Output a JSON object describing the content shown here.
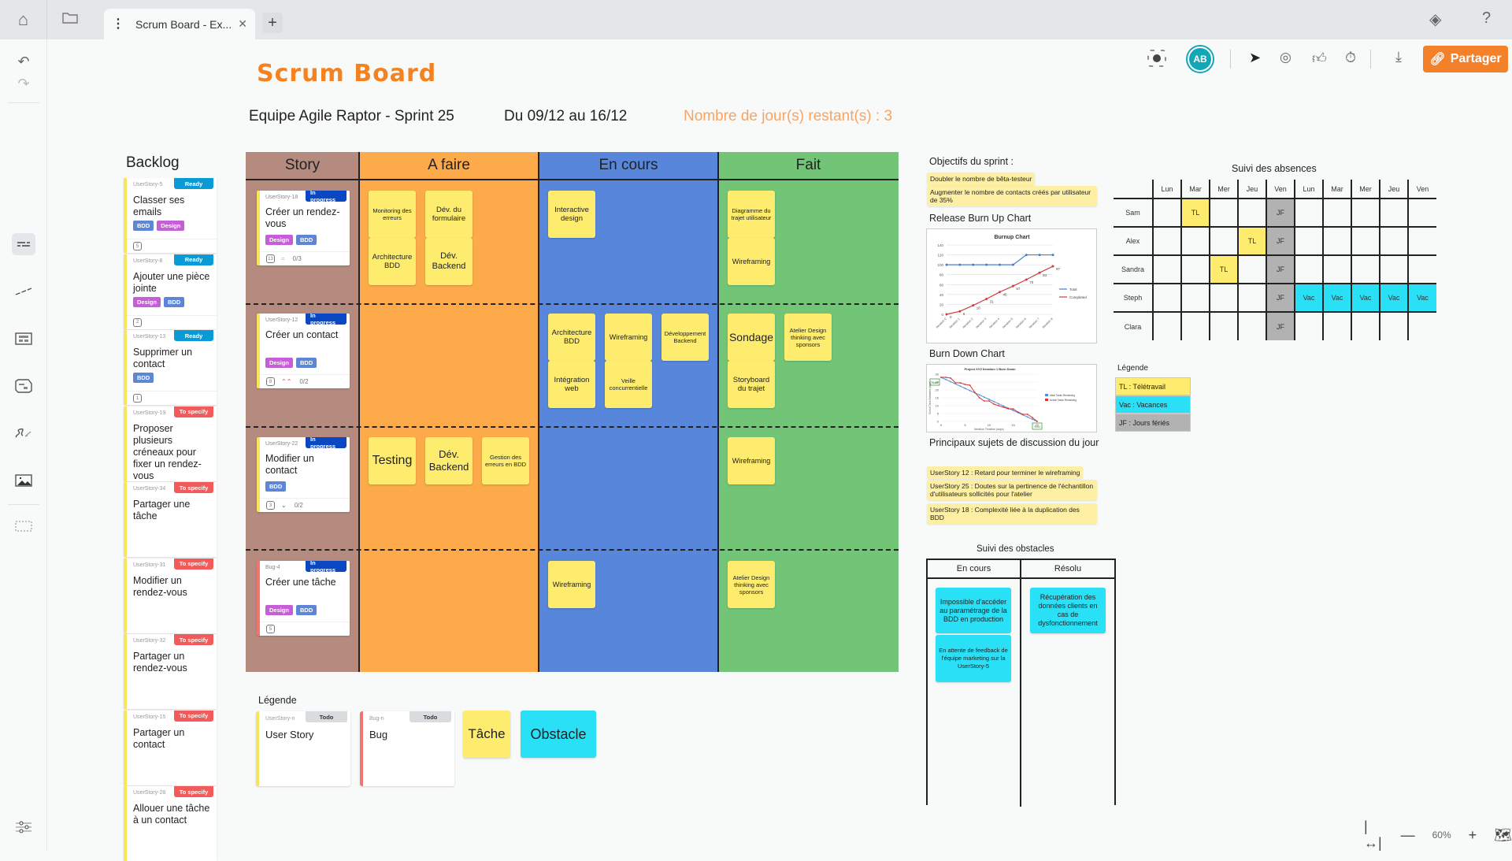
{
  "topbar": {
    "tab_title": "Scrum Board - Ex...",
    "share_label": "Partager",
    "avatar_initials": "AB",
    "zoom_level": "60%"
  },
  "page": {
    "title": "Scrum Board",
    "team": "Equipe Agile Raptor - Sprint 25",
    "dates": "Du 09/12 au 16/12",
    "days_left": "Nombre de jour(s) restant(s) : 3"
  },
  "colors": {
    "story": "#b58b7f",
    "todo": "#fdaa4b",
    "inprogress": "#5886da",
    "done": "#72c577",
    "sticky": "#fdec6e",
    "obstacle": "#29e0f7",
    "accent": "#f2812a"
  },
  "backlog": {
    "title": "Backlog",
    "items": [
      {
        "id": "UserStory-5",
        "status": "Ready",
        "text": "Classer ses emails",
        "tags": [
          "BDD",
          "Design"
        ],
        "points": "5"
      },
      {
        "id": "UserStory-8",
        "status": "Ready",
        "text": "Ajouter une pièce jointe",
        "tags": [
          "Design",
          "BDD"
        ],
        "points": "2"
      },
      {
        "id": "UserStory-13",
        "status": "Ready",
        "text": "Supprimer un contact",
        "tags": [
          "BDD"
        ],
        "points": "1"
      },
      {
        "id": "UserStory-19",
        "status": "To specify",
        "text": "Proposer plusieurs créneaux pour fixer un rendez-vous"
      },
      {
        "id": "UserStory-34",
        "status": "To specify",
        "text": "Partager une tâche"
      },
      {
        "id": "UserStory-31",
        "status": "To specify",
        "text": "Modifier un rendez-vous"
      },
      {
        "id": "UserStory-32",
        "status": "To specify",
        "text": "Partager un rendez-vous"
      },
      {
        "id": "UserStory-15",
        "status": "To specify",
        "text": "Partager un contact"
      },
      {
        "id": "UserStory-28",
        "status": "To specify",
        "text": "Allouer une tâche à un contact"
      }
    ]
  },
  "board": {
    "columns": [
      "Story",
      "A faire",
      "En cours",
      "Fait"
    ],
    "stories": [
      {
        "id": "UserStory-18",
        "status": "In progress",
        "text": "Créer un rendez-vous",
        "tags": [
          "Design",
          "BDD"
        ],
        "points": "13",
        "priority": "=",
        "checklist": "0/3"
      },
      {
        "id": "UserStory-12",
        "status": "In progress",
        "text": "Créer un contact",
        "tags": [
          "Design",
          "BDD"
        ],
        "points": "8",
        "priority": "⌃⌃",
        "checklist": "0/2"
      },
      {
        "id": "UserStory-22",
        "status": "In progress",
        "text": "Modifier un contact",
        "tags": [
          "BDD"
        ],
        "points": "3",
        "priority": "⌄",
        "checklist": "0/2"
      },
      {
        "id": "Bug-4",
        "status": "In progress",
        "text": "Créer une tâche",
        "tags": [
          "Design",
          "BDD"
        ],
        "points": "5"
      }
    ],
    "tasks": {
      "row1": {
        "todo": [
          "Monitoring des erreurs",
          "Dév. du formulaire",
          "Architecture BDD",
          "Dév. Backend"
        ],
        "inprogress": [
          "Interactive design"
        ],
        "done": [
          "Diagramme du trajet utilisateur",
          "Wireframing"
        ]
      },
      "row2": {
        "todo": [],
        "inprogress": [
          "Architecture BDD",
          "Wireframing",
          "Développement Backend",
          "Intégration web",
          "Veille concurrentielle"
        ],
        "done": [
          "Sondage",
          "Atelier Design thinking avec sponsors",
          "Storyboard du trajet"
        ]
      },
      "row3": {
        "todo": [
          "Testing",
          "Dév. Backend",
          "Gestion des erreurs en BDD"
        ],
        "inprogress": [],
        "done": [
          "Wireframing"
        ]
      },
      "row4": {
        "todo": [],
        "inprogress": [
          "Wireframing"
        ],
        "done": [
          "Atelier Design thinking avec sponsors"
        ]
      }
    }
  },
  "legend_bottom": {
    "title": "Légende",
    "userstory": {
      "id": "UserStory-n",
      "status": "Todo",
      "text": "User Story"
    },
    "bug": {
      "id": "Bug-n",
      "status": "Todo",
      "text": "Bug"
    },
    "task": "Tâche",
    "obstacle": "Obstacle"
  },
  "objectives": {
    "title": "Objectifs du sprint :",
    "items": [
      "Doubler le nombre de bêta-testeur",
      "Augmenter le nombre de contacts créés par utilisateur de 35%"
    ]
  },
  "burnup": {
    "label": "Release Burn Up Chart",
    "chart_data": {
      "type": "line",
      "title": "Burnup Chart",
      "categories": [
        "Iteration 0",
        "Iteration 1",
        "Iteration 2",
        "Iteration 3",
        "Iteration 4",
        "Iteration 5",
        "Iteration 6",
        "Iteration 7",
        "Iteration 8"
      ],
      "series": [
        {
          "name": "Total",
          "color": "#4a7cc9",
          "values": [
            100,
            100,
            100,
            100,
            100,
            100,
            120,
            120,
            120
          ]
        },
        {
          "name": "Completed",
          "color": "#c9403f",
          "values": [
            0,
            6,
            18,
            31,
            45,
            57,
            70,
            84,
            97
          ]
        }
      ],
      "ylim": [
        0,
        140
      ],
      "yticks": [
        0,
        20,
        40,
        60,
        80,
        100,
        120,
        140
      ],
      "legend": "right"
    }
  },
  "burndown": {
    "label": "Burn Down Chart",
    "chart_data": {
      "type": "line",
      "title": "Project XYZ Iteration 1 Burn Down",
      "xlabel": "Iteration Timeline (days)",
      "ylabel": "Sum of Task Estimates (days)",
      "x": [
        0,
        1,
        2,
        3,
        4,
        5,
        6,
        7,
        8,
        9,
        10,
        11,
        12,
        13,
        14,
        15,
        16,
        17,
        18,
        19,
        20
      ],
      "series": [
        {
          "name": "Ideal Tasks Remaining",
          "color": "#4a8ee0",
          "values": [
            28,
            26.6,
            25.2,
            23.8,
            22.4,
            21,
            19.6,
            18.2,
            16.8,
            15.4,
            14,
            12.6,
            11.2,
            9.8,
            8.4,
            7,
            5.6,
            4.2,
            2.8,
            1.4,
            0
          ]
        },
        {
          "name": "Actual Tasks Remaining",
          "color": "#d9332b",
          "values": [
            28,
            28,
            27.5,
            24.5,
            24.5,
            23.5,
            23,
            18.5,
            15,
            13,
            13,
            11,
            10,
            9,
            8,
            8,
            6,
            4.5,
            4.5,
            2.5,
            0
          ]
        }
      ],
      "ylim": [
        0,
        30
      ],
      "yticks": [
        0,
        5,
        10,
        15,
        20,
        25,
        30
      ],
      "xticks": [
        0,
        5,
        10,
        15,
        20
      ],
      "annotations": [
        "Start",
        "End"
      ],
      "legend": "right"
    }
  },
  "discussion": {
    "title": "Principaux sujets de discussion du jour",
    "items": [
      "UserStory 12 : Retard pour terminer le wireframing",
      "UserStory 25 : Doutes sur la pertinence de l'échantillon d'utilisateurs sollicités pour l'atelier",
      "UserStory 18 : Complexité liée à la duplication des BDD"
    ]
  },
  "absences": {
    "title": "Suivi des absences",
    "days": [
      "Lun",
      "Mar",
      "Mer",
      "Jeu",
      "Ven",
      "Lun",
      "Mar",
      "Mer",
      "Jeu",
      "Ven"
    ],
    "rows": [
      {
        "name": "Sam",
        "cells": [
          "",
          "TL",
          "",
          "",
          "JF",
          "",
          "",
          "",
          "",
          ""
        ]
      },
      {
        "name": "Alex",
        "cells": [
          "",
          "",
          "",
          "TL",
          "JF",
          "",
          "",
          "",
          "",
          ""
        ]
      },
      {
        "name": "Sandra",
        "cells": [
          "",
          "",
          "TL",
          "",
          "JF",
          "",
          "",
          "",
          "",
          ""
        ]
      },
      {
        "name": "Steph",
        "cells": [
          "",
          "",
          "",
          "",
          "JF",
          "Vac",
          "Vac",
          "Vac",
          "Vac",
          "Vac"
        ]
      },
      {
        "name": "Clara",
        "cells": [
          "",
          "",
          "",
          "",
          "JF",
          "",
          "",
          "",
          "",
          ""
        ]
      }
    ],
    "legend_title": "Légende",
    "legend": [
      "TL : Télétravail",
      "Vac : Vacances",
      "JF : Jours fériés"
    ]
  },
  "obstacles": {
    "title": "Suivi des obstacles",
    "columns": [
      "En cours",
      "Résolu"
    ],
    "ongoing": [
      "Impossible d'accéder au paramétrage de la BDD en production",
      "En attente de feedback de l'équipe marketing sur la UserStory-5"
    ],
    "resolved": [
      "Récupération des données clients en cas de dysfonctionnement"
    ]
  }
}
